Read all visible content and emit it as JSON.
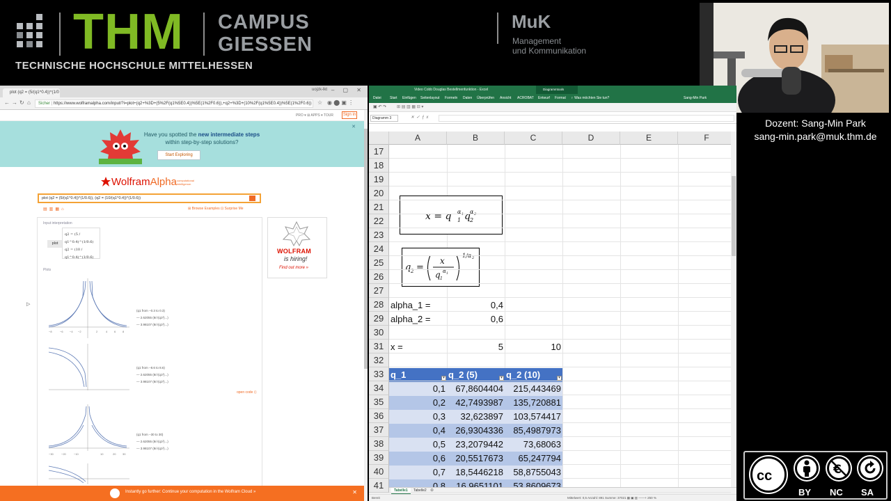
{
  "banner": {
    "thm": "THM",
    "thm_subtitle": "TECHNISCHE HOCHSCHULE MITTELHESSEN",
    "campus_line1": "CAMPUS",
    "campus_line2": "GIESSEN",
    "muk": "MuK",
    "muk_line1": "Management",
    "muk_line2": "und Kommunikation"
  },
  "lecturer": {
    "name": "Dozent: Sang-Min Park",
    "email": "sang-min.park@muk.thm.de"
  },
  "browser": {
    "tab_title": "plot (q2 = (5/(q1^0.4))^(1/0",
    "window_user": "uojzk-lkt",
    "secure_label": "Sicher",
    "url": "https://www.wolframalpha.com/input/?i=plot+(q2+%3D+(5%2F(q1%5E0.4))%5E(1%2F0.6)),+q2+%3D+(10%2F(q1%5E0.4))%5E(1%2F0.6))",
    "top_menu": "PRO ▾   ⊞ APPS ▾   TOUR",
    "sign_in": "Sign in",
    "promo_line1": "Have you spotted the ",
    "promo_bold": "new intermediate steps",
    "promo_line2": "within step-by-step solutions?",
    "promo_button": "Start Exploring",
    "logo_wolfram": "Wolfram",
    "logo_alpha": "Alpha",
    "logo_tag": "computational intelligence.",
    "query": "plot (q2 = (5/(q1^0.4))^(1/0.6)), (q2 = (10/(q1^0.4))^(1/0.6))",
    "query_links": "⊞ Browse Examples   ⊡ Surprise Me",
    "input_interpretation": "Input interpretation",
    "plot_button": "plot",
    "interp_line1": "q2 = (5 / q1^0.4)^(1/0.6)",
    "interp_line2": "q2 = (10 / q1^0.4)^(1/0.6)",
    "plots_title": "Plots",
    "legend_ranges": [
      "(q1 from −0.3 to 0.3)",
      "(q1 from −8.6 to 8.6)",
      "(q1 from −30 to 30)"
    ],
    "legend_entry1": "— 2.62055 (8/√(q1²)...)",
    "legend_entry2": "— 3.98107 (8/√(q1²)...)",
    "open_code": "open code ⟨⟩",
    "ad_wolfram": "WOLFRAM",
    "ad_hiring": "is hiring!",
    "ad_findout": "Find out more »",
    "bottom_bar": "Instantly go further: Continue your computation in the Wolfram Cloud »"
  },
  "excel": {
    "title": "Video Cobb Douglas Bestellmenfunktion - Excel",
    "diagram_tools": "Diagrammtools",
    "ribbon_tabs": [
      "Datei",
      "Start",
      "Einfügen",
      "Seitenlayout",
      "Formeln",
      "Daten",
      "Überprüfen",
      "Ansicht",
      "ACROBAT",
      "Entwurf",
      "Format"
    ],
    "tell_me": "♀ Was möchten Sie tun?",
    "user": "Sang-Min Park",
    "name_box": "Diagramm 3",
    "columns": [
      "A",
      "B",
      "C",
      "D",
      "E",
      "F"
    ],
    "rows": [
      "17",
      "18",
      "19",
      "20",
      "21",
      "22",
      "23",
      "24",
      "25",
      "26",
      "27",
      "28",
      "29",
      "30",
      "31",
      "32",
      "33",
      "34",
      "35",
      "36",
      "37",
      "38",
      "39",
      "40",
      "41"
    ],
    "eq1": "x = q1^α1 q2^α2",
    "eq2": "q2 = (x / q1^α1)^(1/α2)",
    "alpha1_label": "alpha_1 =",
    "alpha1_value": "0,4",
    "alpha2_label": "alpha_2 =",
    "alpha2_value": "0,6",
    "x_label": "x =",
    "x_value1": "5",
    "x_value2": "10",
    "table_headers": [
      "q_1",
      "q_2 (5)",
      "q_2 (10)"
    ],
    "table_rows": [
      [
        "0,1",
        "67,8604404",
        "215,443469"
      ],
      [
        "0,2",
        "42,7493987",
        "135,720881"
      ],
      [
        "0,3",
        "32,623897",
        "103,574417"
      ],
      [
        "0,4",
        "26,9304336",
        "85,4987973"
      ],
      [
        "0,5",
        "23,2079442",
        "73,68063"
      ],
      [
        "0,6",
        "20,5517673",
        "65,247794"
      ],
      [
        "0,7",
        "18,5446218",
        "58,8755043"
      ],
      [
        "0,8",
        "16,9651101",
        "53,8609673"
      ]
    ],
    "sheet_tabs": [
      "Tabelle1",
      "Tabelle2"
    ],
    "status_left": "Bereit",
    "status_right": "Mittelwert: 0,5  Anzahl: 891  Summe: 37021  ▦ ▣ ▥  ——+  250 %"
  },
  "license": {
    "labels": [
      "BY",
      "NC",
      "SA"
    ],
    "icons": [
      "cc-icon",
      "person-icon",
      "no-euro-icon",
      "share-alike-icon"
    ]
  }
}
